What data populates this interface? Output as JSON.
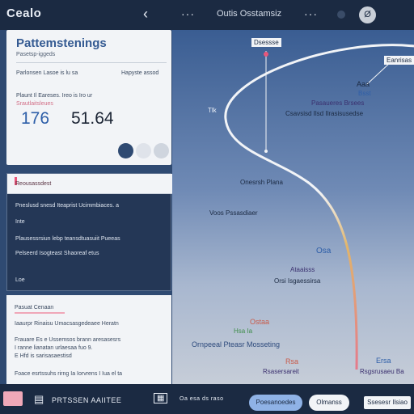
{
  "header": {
    "app_title": "Cealo",
    "back_icon": "chevron-left-icon",
    "menu_dots": "···",
    "title": "Outis Osstamsiz",
    "avatar_letter": "Ø"
  },
  "panel_top": {
    "heading": "Pattemstenings",
    "subheading": "Pasetsp-iggeds",
    "meta_left": "Parlonsen Lasoe is lu sa",
    "meta_right": "Hapyste assod",
    "meta_line": "Plaunt Il Eareses. Ireo is Iro ur",
    "meta_pink": "Srautlaitsleues",
    "value_primary": "176",
    "value_secondary": "51.64",
    "swatch_colors": [
      "#2f4a72",
      "#dfe3ea",
      "#cfd5de"
    ]
  },
  "panel_middle": {
    "tab_label": "Reousassdest",
    "accent": "#e9567a",
    "lines": [
      "Pneslusd snesd Iteaprist Ucimmbiaces. a",
      "Inte",
      "Plausessrsiun lebp teansdtuasuiit Pueeas",
      "Pelseerd Isogteast Shaoreaf etus",
      "Loe"
    ]
  },
  "panel_bottom": {
    "lines": [
      "Pasuat Cenaan",
      "Iaaurpr Rinaisu Umacsasgedeaee Heratn",
      "Frauare Es e Ussemsos brann aresasesrs",
      "I ranne lianatan urlaesaa fuo 9.",
      "E Hfd is sarisasaestisd",
      "Foace esrtssuhs rirng Ia Iorvrens I Iua el ta"
    ],
    "highlight": "#f0a7b8"
  },
  "map": {
    "route_colors": {
      "top": "#f2f4f7",
      "mid": "#e2b56a",
      "bottom": "#e47a8c"
    },
    "labels": [
      {
        "text": "Dsessse",
        "color": "#1b2a42"
      },
      {
        "text": "Eanrisas",
        "color": "#1b2a42"
      },
      {
        "text": "Aaa",
        "color": "#1b2a42"
      },
      {
        "text": "Bsst",
        "color": "#2d5ea8"
      },
      {
        "text": "Pasaueres Brsees",
        "color": "#3a2f6e"
      },
      {
        "text": "Csavsisd Ilsd Ilrasisusedse",
        "color": "#1b2a42"
      },
      {
        "text": "Tlk",
        "color": "#e9eef6"
      },
      {
        "text": "Onesrsh Plana",
        "color": "#1b2a42"
      },
      {
        "text": "Voos Pssasdiaer",
        "color": "#1b2a42"
      },
      {
        "text": "Osa",
        "color": "#2d5ea8"
      },
      {
        "text": "Ataaisss",
        "color": "#3a2f6e"
      },
      {
        "text": "Orsi Isgaessirsa",
        "color": "#1b2a42"
      },
      {
        "text": "Ostaa",
        "color": "#c85b4a"
      },
      {
        "text": "Hsa Ia",
        "color": "#3e8d4a"
      },
      {
        "text": "Ornpeeal Pteasr Mosseting",
        "color": "#2d4a7c"
      },
      {
        "text": "Rsa",
        "color": "#c85b4a"
      },
      {
        "text": "Rsasersareit",
        "color": "#3a2f6e"
      },
      {
        "text": "Ersa",
        "color": "#2d5ea8"
      },
      {
        "text": "Rsgsrusaeu Ba",
        "color": "#3a2f6e"
      }
    ]
  },
  "footer": {
    "left_icon": "image-icon",
    "label": "PRTSSEN AAIITEE",
    "calendar_icon": "calendar-icon",
    "small_text": "Oa esa ds raso",
    "btn1": "Poesanoedes",
    "btn2": "Olmanss",
    "chip": "Ssesesr Ilsiao",
    "accent": "#f0a8b8"
  }
}
